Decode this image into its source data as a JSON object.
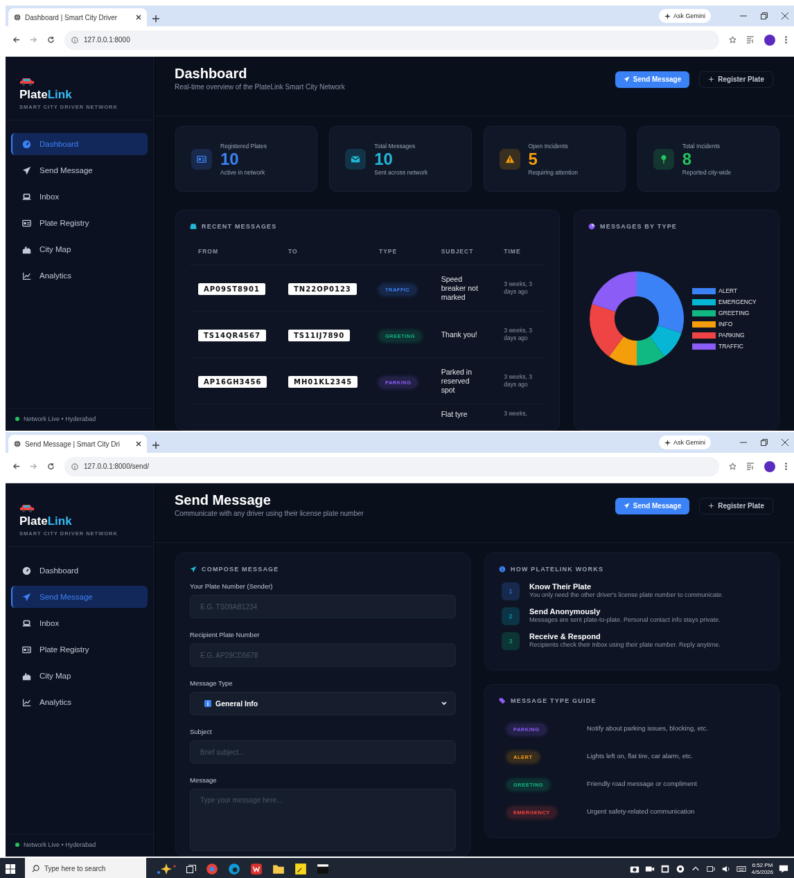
{
  "screens": [
    {
      "browser": {
        "tab_title": "Dashboard | Smart City Driver",
        "url": "127.0.0.1:8000",
        "ask_label": "Ask Gemini"
      },
      "app": {
        "sidebar": {
          "brand_first": "Plate",
          "brand_second": "Link",
          "tagline": "SMART CITY DRIVER NETWORK",
          "nav": [
            {
              "label": "Dashboard",
              "selected": true
            },
            {
              "label": "Send Message",
              "selected": false
            },
            {
              "label": "Inbox",
              "selected": false
            },
            {
              "label": "Plate Registry",
              "selected": false
            },
            {
              "label": "City Map",
              "selected": false
            },
            {
              "label": "Analytics",
              "selected": false
            }
          ],
          "footer": "Network Live • Hyderabad"
        },
        "header": {
          "title": "Dashboard",
          "subtitle": "Real-time overview of the PlateLink Smart City Network",
          "buttons": [
            {
              "label": "Send Message",
              "kind": "primary"
            },
            {
              "label": "Register Plate",
              "kind": "secondary"
            }
          ]
        },
        "page": {
          "kind": "dashboard",
          "stats": [
            {
              "label": "Registered Plates",
              "value": "10",
              "note": "Active in network",
              "color": "#3b82f6"
            },
            {
              "label": "Total Messages",
              "value": "10",
              "note": "Sent across network",
              "color": "#22b8d8"
            },
            {
              "label": "Open Incidents",
              "value": "5",
              "note": "Requiring attention",
              "color": "#f59e0b"
            },
            {
              "label": "Total Incidents",
              "value": "8",
              "note": "Reported city-wide",
              "color": "#22c55e"
            }
          ],
          "recent_messages": {
            "title": "RECENT MESSAGES",
            "columns": [
              "FROM",
              "TO",
              "TYPE",
              "SUBJECT",
              "TIME"
            ],
            "rows": [
              {
                "from": "AP09ST8901",
                "to": "TN22OP0123",
                "type": {
                  "text": "TRAFFIC",
                  "color": "#3b82f6"
                },
                "subject": "Speed breaker not marked",
                "time": "3 weeks, 3 days ago"
              },
              {
                "from": "TS14QR4567",
                "to": "TS11IJ7890",
                "type": {
                  "text": "GREETING",
                  "color": "#10b981"
                },
                "subject": "Thank you!",
                "time": "3 weeks, 3 days ago"
              },
              {
                "from": "AP16GH3456",
                "to": "MH01KL2345",
                "type": {
                  "text": "PARKING",
                  "color": "#8b5cf6"
                },
                "subject": "Parked in reserved spot",
                "time": "3 weeks, 3 days ago"
              },
              {
                "subject": "Flat tyre",
                "time": "3 weeks,"
              }
            ]
          },
          "type_chart": {
            "chart_data": {
              "type": "donut",
              "title": "MESSAGES BY TYPE",
              "categories": [
                "ALERT",
                "EMERGENCY",
                "GREETING",
                "INFO",
                "PARKING",
                "TRAFFIC"
              ],
              "values": [
                30,
                10,
                10,
                10,
                20,
                20
              ],
              "legend": "right"
            }
          }
        }
      }
    },
    {
      "browser": {
        "tab_title": "Send Message | Smart City Dri",
        "url": "127.0.0.1:8000/send/",
        "ask_label": "Ask Gemini"
      },
      "app": {
        "sidebar": {
          "brand_first": "Plate",
          "brand_second": "Link",
          "tagline": "SMART CITY DRIVER NETWORK",
          "nav": [
            {
              "label": "Dashboard",
              "selected": false
            },
            {
              "label": "Send Message",
              "selected": true
            },
            {
              "label": "Inbox",
              "selected": false
            },
            {
              "label": "Plate Registry",
              "selected": false
            },
            {
              "label": "City Map",
              "selected": false
            },
            {
              "label": "Analytics",
              "selected": false
            }
          ],
          "footer": "Network Live • Hyderabad"
        },
        "header": {
          "title": "Send Message",
          "subtitle": "Communicate with any driver using their license plate number",
          "buttons": [
            {
              "label": "Send Message",
              "kind": "primary"
            },
            {
              "label": "Register Plate",
              "kind": "secondary"
            }
          ]
        },
        "page": {
          "kind": "send",
          "compose": {
            "title": "COMPOSE MESSAGE",
            "fields": [
              {
                "kind": "input",
                "label": "Your Plate Number (Sender)",
                "placeholder": "E.G. TS09AB1234"
              },
              {
                "kind": "input",
                "label": "Recipient Plate Number",
                "placeholder": "E.G. AP29CD5678"
              },
              {
                "kind": "select",
                "label": "Message Type",
                "value": "General Info"
              },
              {
                "kind": "input",
                "label": "Subject",
                "placeholder": "Brief subject..."
              },
              {
                "kind": "textarea",
                "label": "Message",
                "placeholder": "Type your message here..."
              }
            ]
          },
          "how_it_works": {
            "title": "HOW PLATELINK WORKS",
            "steps": [
              {
                "number": "1",
                "title": "Know Their Plate",
                "text": "You only need the other driver's license plate number to communicate."
              },
              {
                "number": "2",
                "title": "Send Anonymously",
                "text": "Messages are sent plate-to-plate. Personal contact info stays private."
              },
              {
                "number": "3",
                "title": "Receive & Respond",
                "text": "Recipients check their Inbox using their plate number. Reply anytime."
              }
            ]
          },
          "type_guide": {
            "title": "MESSAGE TYPE GUIDE",
            "rows": [
              {
                "badge": "PARKING",
                "color": "#8b5cf6",
                "text": "Notify about parking issues, blocking, etc."
              },
              {
                "badge": "ALERT",
                "color": "#f59e0b",
                "text": "Lights left on, flat tire, car alarm, etc."
              },
              {
                "badge": "GREETING",
                "color": "#10b981",
                "text": "Friendly road message or compliment"
              },
              {
                "badge": "EMERGENCY",
                "color": "#ef4444",
                "text": "Urgent safety-related communication"
              }
            ]
          }
        }
      }
    }
  ],
  "taskbar": {
    "search_placeholder": "Type here to search",
    "time": "6:52 PM",
    "date": "4/5/2026"
  }
}
